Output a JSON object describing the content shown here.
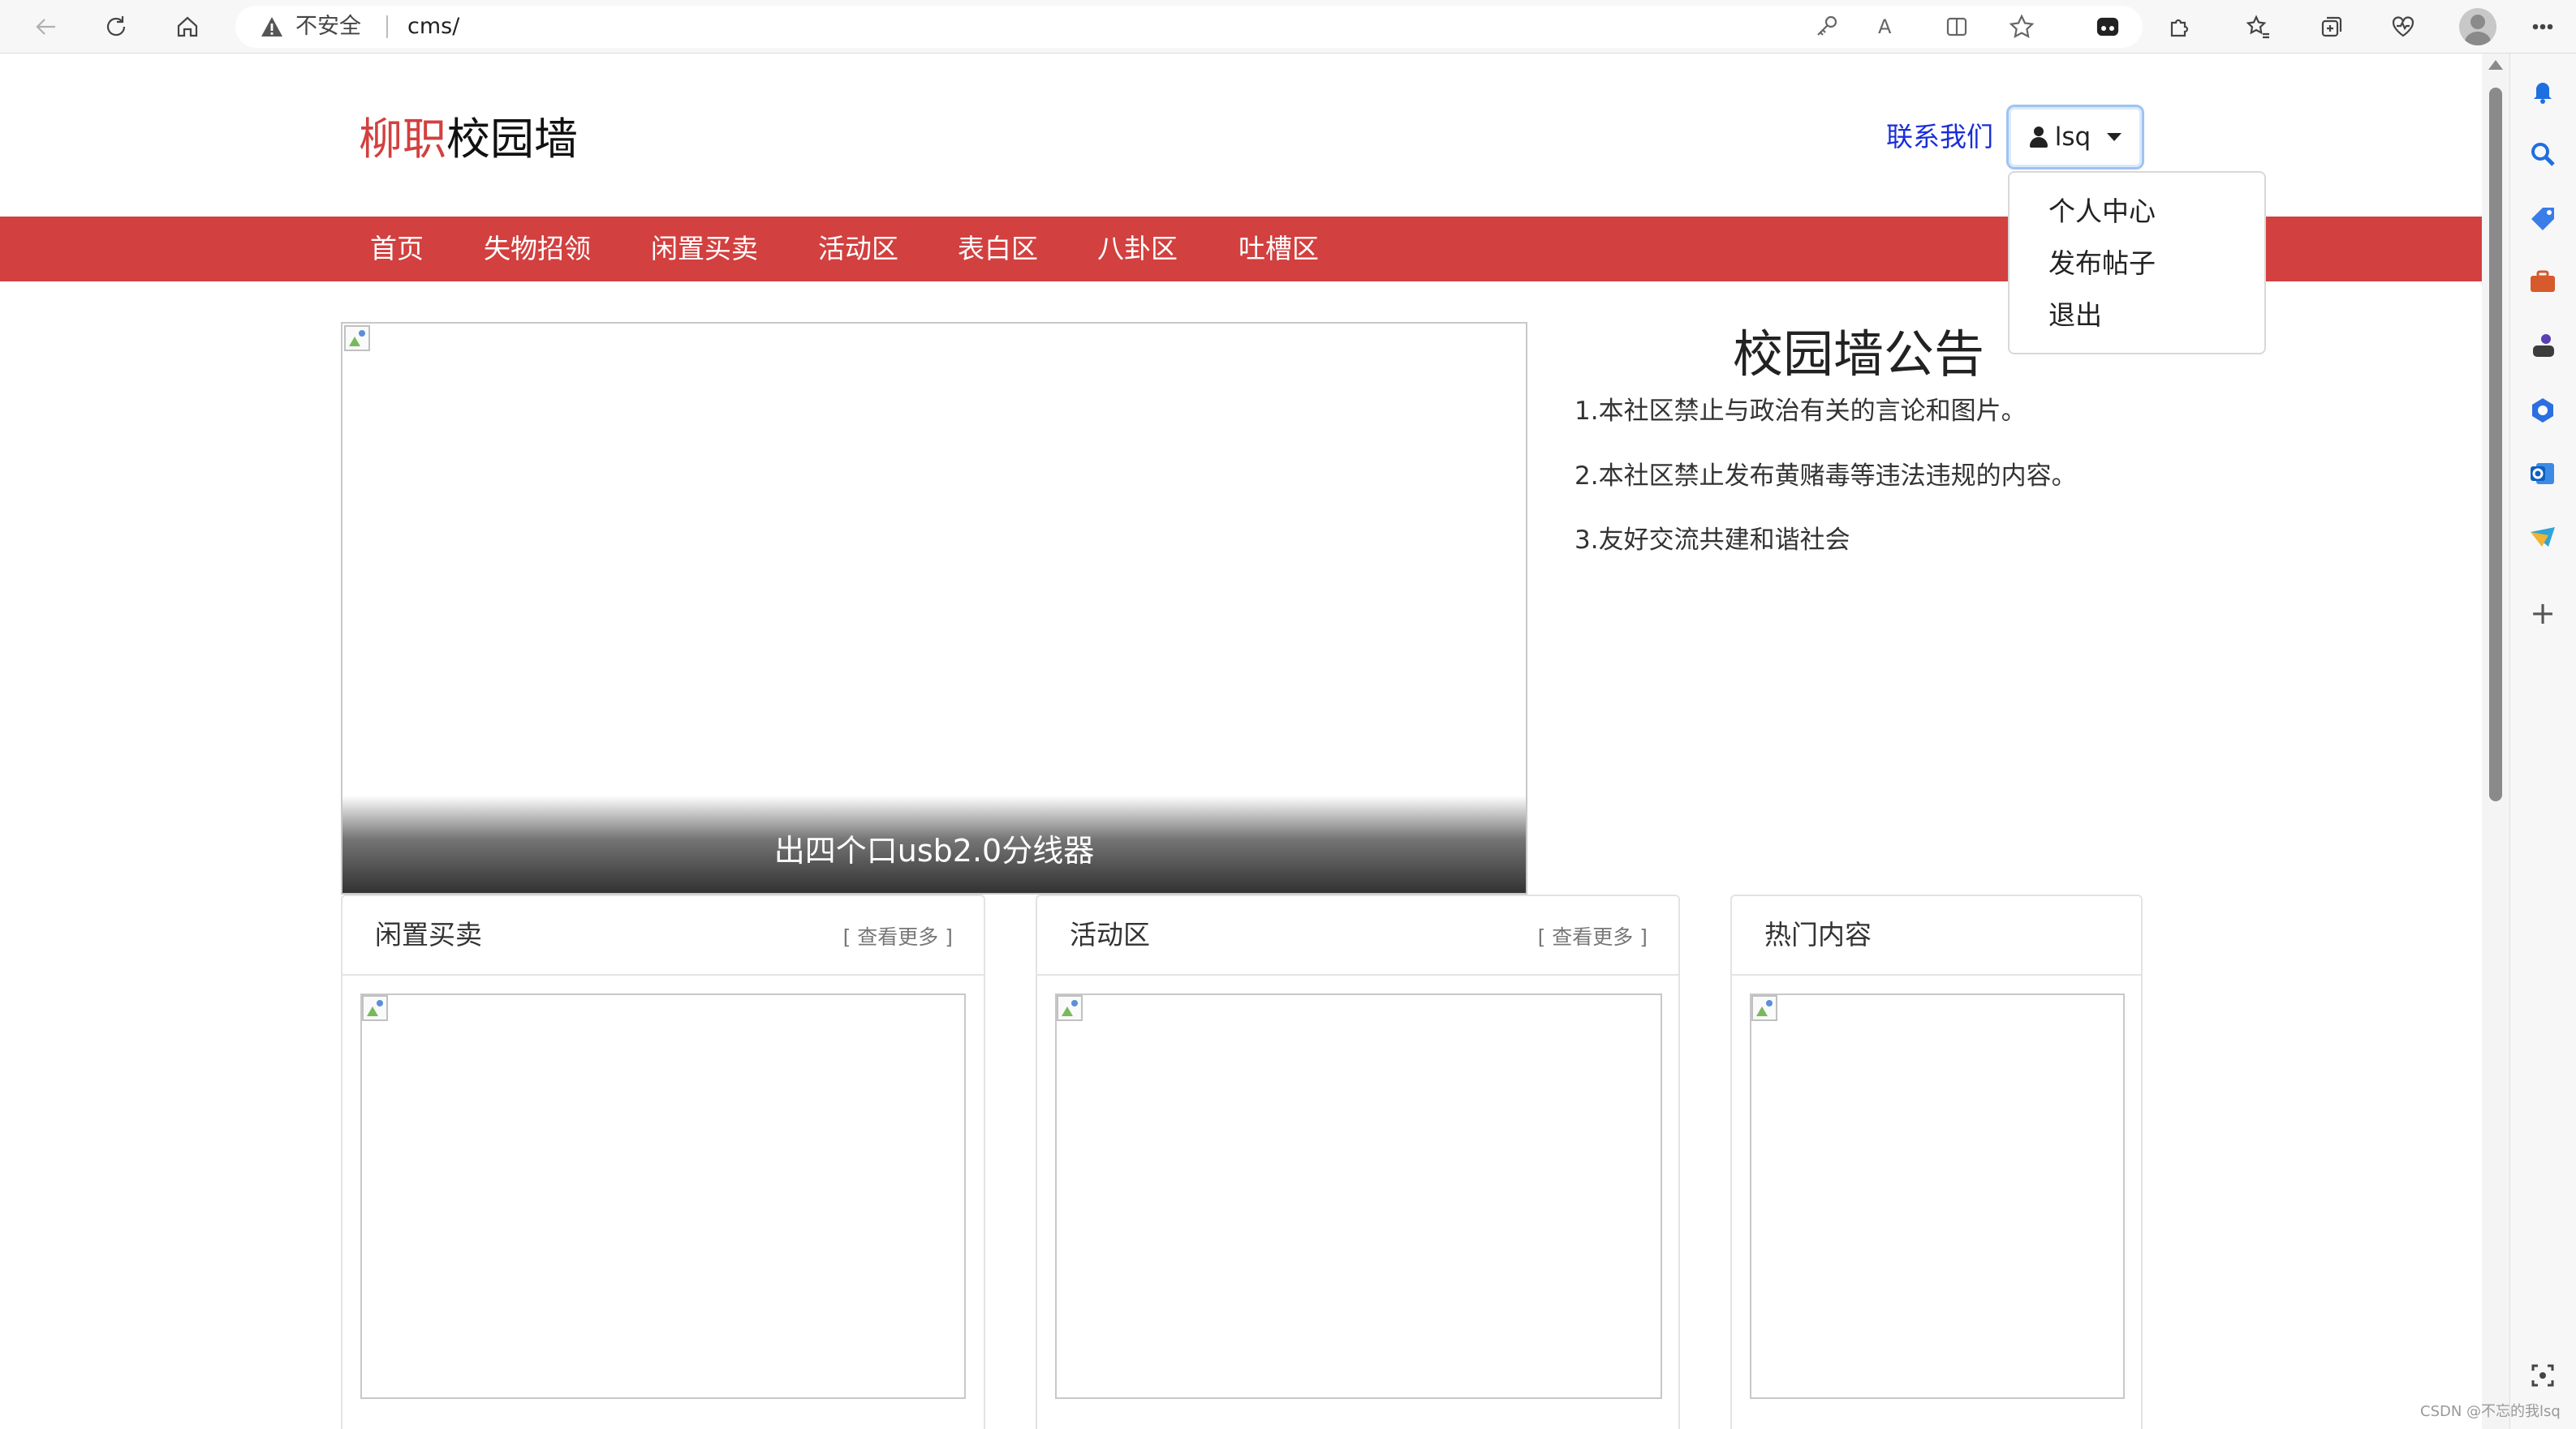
{
  "browser": {
    "address_insecure": "不安全",
    "address_url": "cms/",
    "read_aloud_label": "A"
  },
  "header": {
    "brand_part1": "柳职",
    "brand_part2": "校园墙",
    "contact_label": "联系我们",
    "user_name": "lsq"
  },
  "nav": {
    "items": [
      "首页",
      "失物招领",
      "闲置买卖",
      "活动区",
      "表白区",
      "八卦区",
      "吐槽区"
    ]
  },
  "dropdown": {
    "items": [
      "个人中心",
      "发布帖子",
      "退出"
    ]
  },
  "carousel": {
    "caption": "出四个口usb2.0分线器"
  },
  "notice": {
    "title": "校园墙公告",
    "items": [
      "1.本社区禁止与政治有关的言论和图片。",
      "2.本社区禁止发布黄赌毒等违法违规的内容。",
      "3.友好交流共建和谐社会"
    ]
  },
  "cards": [
    {
      "title": "闲置买卖",
      "more": "[ 查看更多 ]"
    },
    {
      "title": "活动区",
      "more": "[ 查看更多 ]"
    },
    {
      "title": "热门内容",
      "more": ""
    }
  ],
  "watermark": "CSDN @不忘的我lsq",
  "colors": {
    "brand_red": "#d2403f",
    "link_blue": "#1a2fd8"
  }
}
